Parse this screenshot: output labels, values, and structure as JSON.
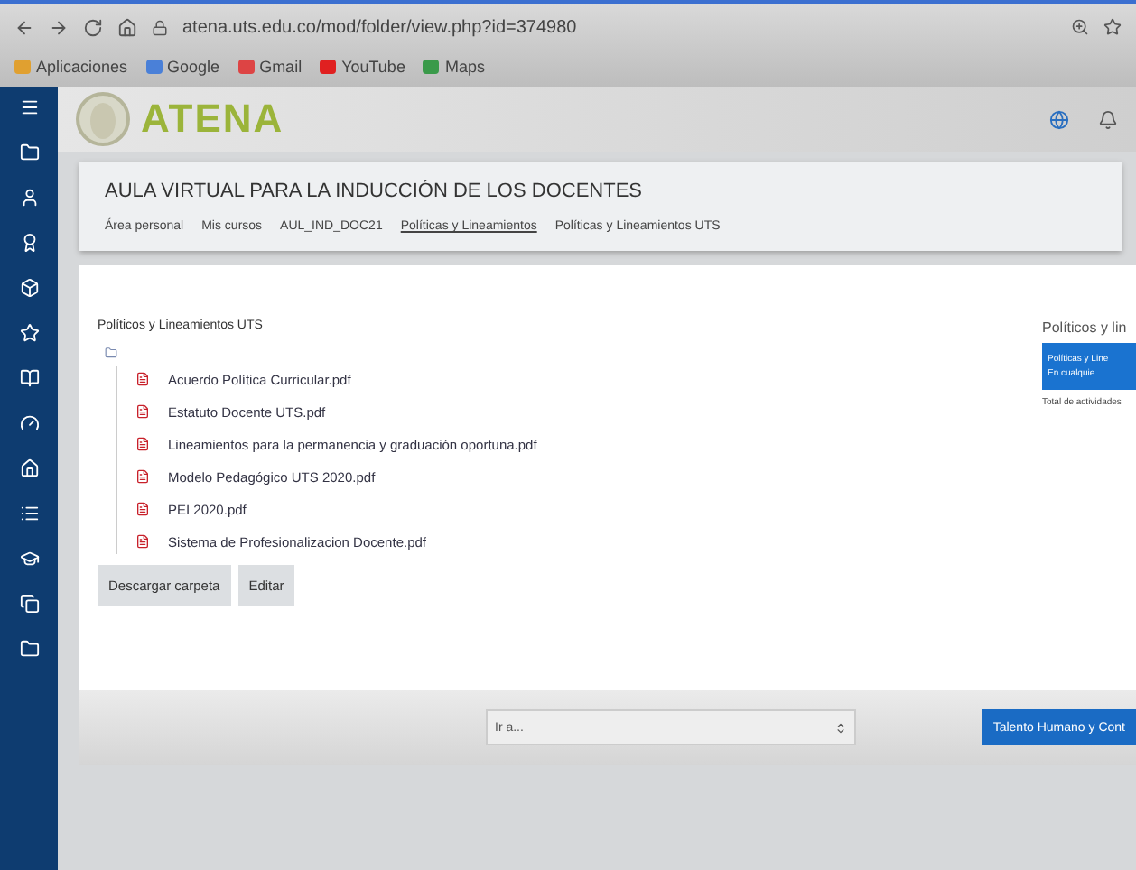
{
  "browser": {
    "url": "atena.uts.edu.co/mod/folder/view.php?id=374980",
    "bookmarks": [
      {
        "kind": "apps",
        "label": "Aplicaciones"
      },
      {
        "kind": "google",
        "label": "Google"
      },
      {
        "kind": "gmail",
        "label": "Gmail"
      },
      {
        "kind": "youtube",
        "label": "YouTube"
      },
      {
        "kind": "maps",
        "label": "Maps"
      }
    ]
  },
  "sidebar": {
    "items": [
      {
        "kind": "menu"
      },
      {
        "kind": "folder"
      },
      {
        "kind": "user"
      },
      {
        "kind": "award"
      },
      {
        "kind": "box"
      },
      {
        "kind": "star"
      },
      {
        "kind": "book"
      },
      {
        "kind": "gauge"
      },
      {
        "kind": "home"
      },
      {
        "kind": "list"
      },
      {
        "kind": "graduation"
      },
      {
        "kind": "copy"
      },
      {
        "kind": "folder"
      }
    ]
  },
  "header": {
    "logo_text": "ATENA"
  },
  "course": {
    "title": "AULA VIRTUAL PARA LA INDUCCIÓN DE LOS DOCENTES",
    "breadcrumb": [
      {
        "label": "Área personal",
        "hovered": false
      },
      {
        "label": "Mis cursos",
        "hovered": false
      },
      {
        "label": "AUL_IND_DOC21",
        "hovered": false
      },
      {
        "label": "Políticas y Lineamientos",
        "hovered": true
      },
      {
        "label": "Políticas y Lineamientos UTS",
        "hovered": false
      }
    ]
  },
  "folder": {
    "title": "Políticos y Lineamientos UTS",
    "files": [
      "Acuerdo Política Curricular.pdf",
      "Estatuto Docente UTS.pdf",
      "Lineamientos para la permanencia y graduación oportuna.pdf",
      "Modelo Pedagógico UTS 2020.pdf",
      "PEI 2020.pdf",
      "Sistema de Profesionalizacion Docente.pdf"
    ],
    "buttons": [
      "Descargar carpeta",
      "Editar"
    ]
  },
  "side_block": {
    "title": "Políticos y lin",
    "card_title": "Políticas y Line",
    "card_line": "En cualquie",
    "footer": "Total de actividades"
  },
  "footer": {
    "jump_placeholder": "Ir a...",
    "next_button": "Talento Humano y Cont"
  }
}
